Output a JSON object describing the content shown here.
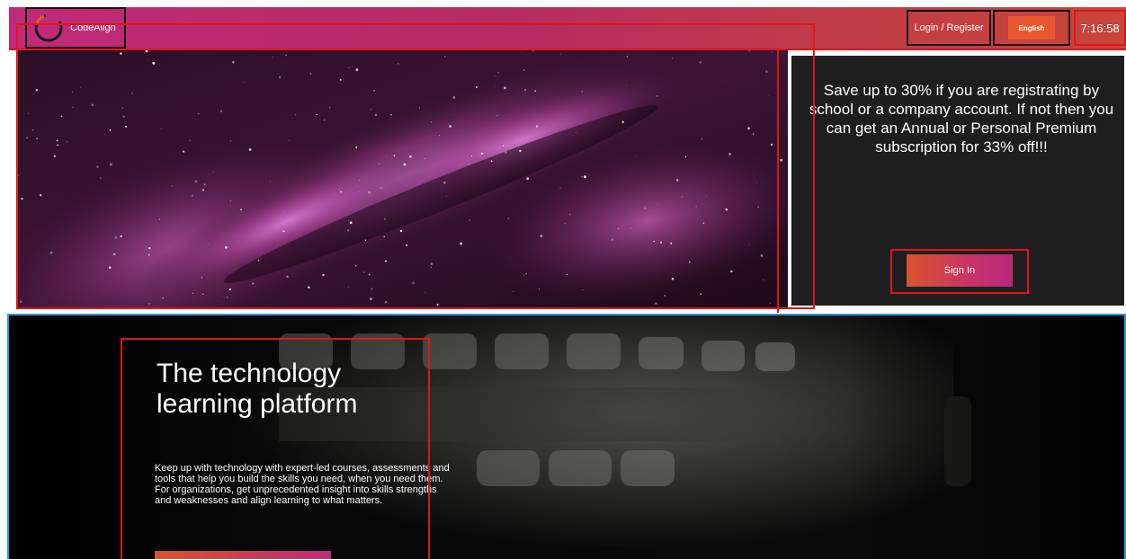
{
  "header": {
    "brand": "CodeAlign",
    "login_label": "Login / Register",
    "language_label": "English",
    "clock_text": "7:16:58"
  },
  "promo": {
    "text": "Save up to 30% if you are registrating by school or a company account. If not then you can get an Annual or Personal Premium subscription for 33% off!!!",
    "signin_label": "Sign In"
  },
  "lower": {
    "headline_line1": "The technology",
    "headline_line2": "learning platform",
    "blurb": "Keep up with technology with expert-led courses, assessments and tools that help you build the skills you need, when you need them. For organizations, get unprecedented insight into skills strengths and weaknesses and align learning to what matters."
  },
  "colors": {
    "header_gradient_start": "#c12a78",
    "header_gradient_end": "#c9443a",
    "accent_orange": "#e9572e",
    "promo_bg": "#1e1e1e",
    "annotation_red": "#e0151a",
    "annotation_blue": "#2b9be0"
  },
  "icons": {
    "logo": "ring-logo-icon"
  }
}
